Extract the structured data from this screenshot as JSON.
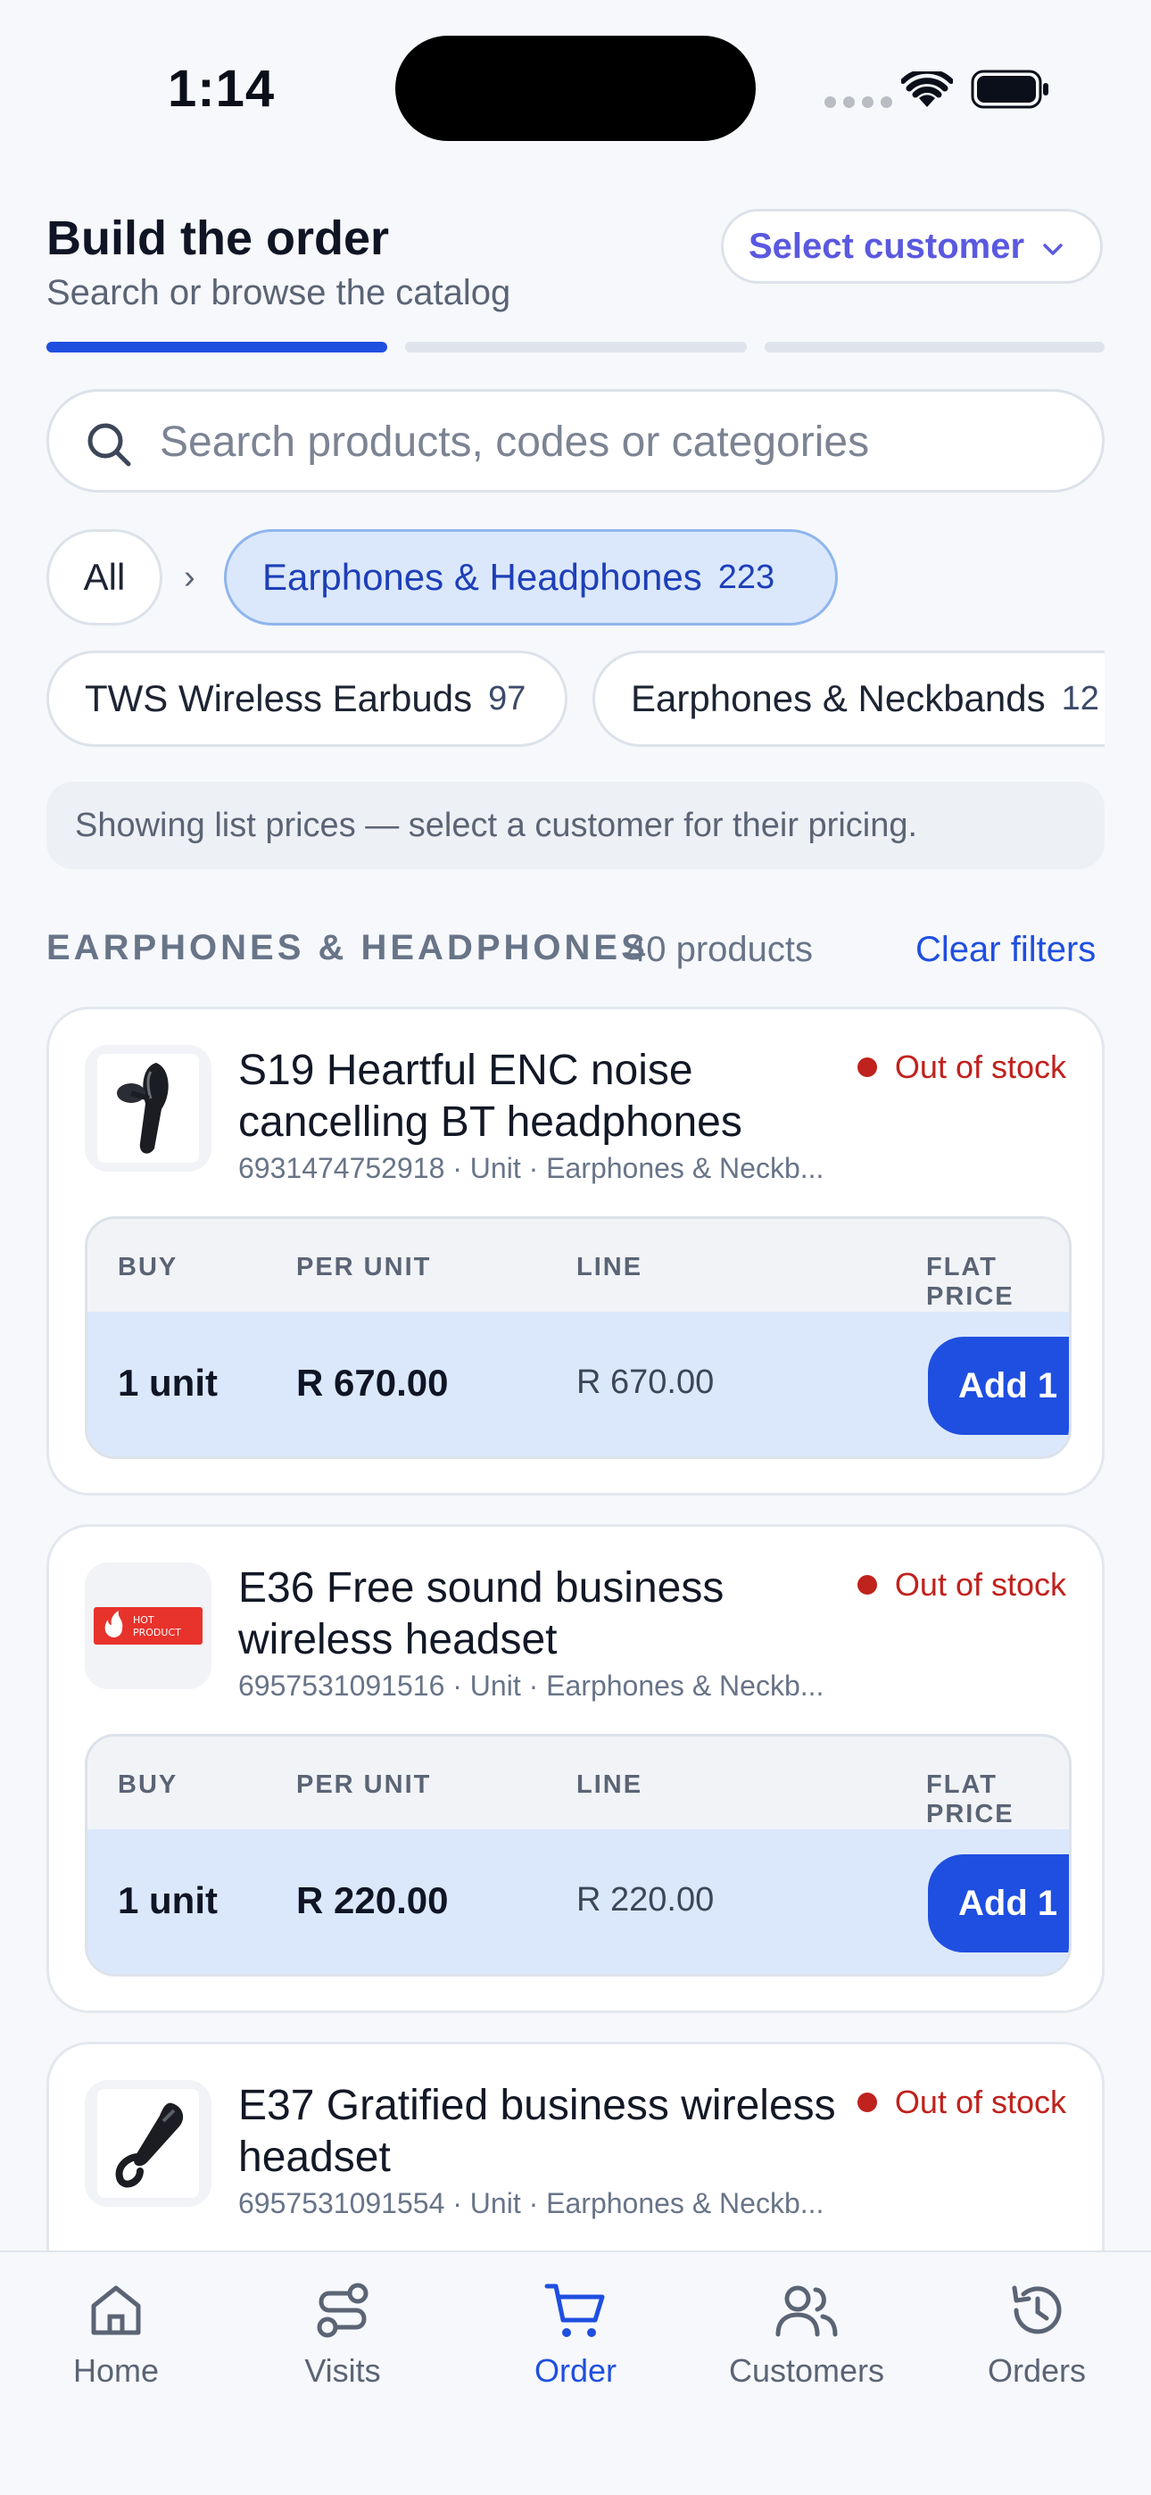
{
  "status_bar": {
    "time": "1:14"
  },
  "header": {
    "title": "Build the order",
    "subtitle": "Search or browse the catalog",
    "customer_select_label": "Select customer"
  },
  "search": {
    "placeholder": "Search products, codes or categories",
    "value": ""
  },
  "breadcrumb": {
    "all": "All",
    "separator": "›"
  },
  "chips": {
    "active": {
      "label": "Earphones & Headphones",
      "count": "223"
    },
    "subcategories": [
      {
        "label": "TWS Wireless Earbuds",
        "count": "97"
      },
      {
        "label": "Earphones & Neckbands",
        "count": "12"
      }
    ]
  },
  "notice": "Showing list prices — select a customer for their pricing.",
  "section": {
    "heading": "EARPHONES & HEADPHONES",
    "count": "40 products",
    "clear_filters": "Clear filters"
  },
  "price_headers": {
    "buy": "BUY",
    "per_unit": "PER UNIT",
    "line": "LINE",
    "flat_price": "FLAT PRICE"
  },
  "products": [
    {
      "name": "S19 Heartful ENC noise cancelling BT headphones",
      "meta": "6931474752918 · Unit · Earphones & Neckb...",
      "stock": "Out of stock",
      "qty": "1 unit",
      "per_unit": "R 670.00",
      "line": "R 670.00",
      "add_label": "Add 1",
      "thumb_icon": "bluetooth-earpiece-icon"
    },
    {
      "name": "E36 Free sound business wireless headset",
      "meta": "6957531091516 · Unit · Earphones & Neckb...",
      "stock": "Out of stock",
      "qty": "1 unit",
      "per_unit": "R 220.00",
      "line": "R 220.00",
      "add_label": "Add 1",
      "thumb_icon": "hot-product-badge-icon",
      "thumb_badge_text": "HOT PRODUCT"
    },
    {
      "name": "E37 Gratified business wireless headset",
      "meta": "6957531091554 · Unit · Earphones & Neckb...",
      "stock": "Out of stock",
      "thumb_icon": "bluetooth-earpiece-icon"
    }
  ],
  "tabs": [
    {
      "label": "Home",
      "icon": "home-icon"
    },
    {
      "label": "Visits",
      "icon": "route-icon"
    },
    {
      "label": "Order",
      "icon": "cart-icon",
      "active": true
    },
    {
      "label": "Customers",
      "icon": "users-icon"
    },
    {
      "label": "Orders",
      "icon": "history-icon"
    }
  ],
  "colors": {
    "accent": "#1f4fe0",
    "stock_out": "#c0221d",
    "chip_active_bg": "#dbe8fc"
  }
}
